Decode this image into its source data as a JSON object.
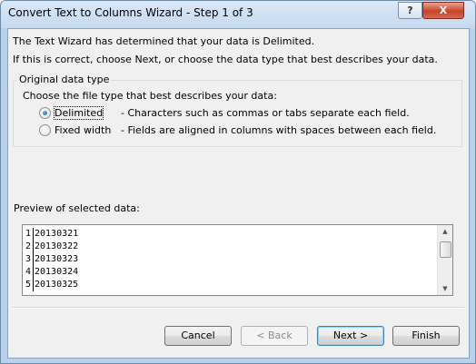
{
  "window": {
    "title": "Convert Text to Columns Wizard - Step 1 of 3",
    "help_label": "?",
    "close_label": "X"
  },
  "intro": {
    "line1": "The Text Wizard has determined that your data is Delimited.",
    "line2": "If this is correct, choose Next, or choose the data type that best describes your data."
  },
  "data_type_group": {
    "title": "Original data type",
    "prompt": "Choose the file type that best describes your data:",
    "options": [
      {
        "label": "Delimited",
        "description": "- Characters such as commas or tabs separate each field.",
        "selected": true
      },
      {
        "label": "Fixed width",
        "description": "- Fields are aligned in columns with spaces between each field.",
        "selected": false
      }
    ]
  },
  "preview": {
    "label": "Preview of selected data:",
    "rows": [
      {
        "num": "1",
        "value": "20130321"
      },
      {
        "num": "2",
        "value": "20130322"
      },
      {
        "num": "3",
        "value": "20130323"
      },
      {
        "num": "4",
        "value": "20130324"
      },
      {
        "num": "5",
        "value": "20130325"
      }
    ]
  },
  "buttons": {
    "cancel": "Cancel",
    "back": "< Back",
    "next": "Next >",
    "finish": "Finish"
  }
}
